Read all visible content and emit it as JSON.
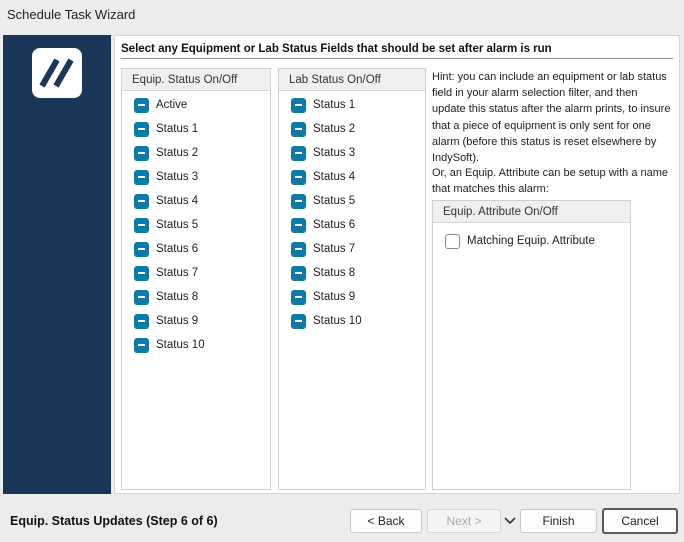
{
  "window": {
    "title": "Schedule Task Wizard"
  },
  "main": {
    "heading": "Select any Equipment or Lab Status Fields that should be set after alarm is run",
    "equip_panel": {
      "header": "Equip. Status On/Off",
      "items": [
        "Active",
        "Status 1",
        "Status 2",
        "Status 3",
        "Status 4",
        "Status 5",
        "Status 6",
        "Status 7",
        "Status 8",
        "Status 9",
        "Status 10"
      ]
    },
    "lab_panel": {
      "header": "Lab Status On/Off",
      "items": [
        "Status 1",
        "Status 2",
        "Status 3",
        "Status 4",
        "Status 5",
        "Status 6",
        "Status 7",
        "Status 8",
        "Status 9",
        "Status 10"
      ]
    },
    "hint": "Hint:  you can include an equipment or lab status field in your alarm selection filter, and then update this status after the alarm prints, to insure that a piece of equipment is only sent for one alarm (before this status is reset elsewhere by IndySoft).",
    "hint2": "Or, an Equip. Attribute can be setup with a name that matches this alarm:",
    "attr_panel": {
      "header": "Equip. Attribute On/Off",
      "item": "Matching Equip. Attribute"
    }
  },
  "footer": {
    "step_title": "Equip. Status Updates (Step 6 of 6)",
    "back": "< Back",
    "next": "Next >",
    "finish": "Finish",
    "cancel": "Cancel"
  },
  "colors": {
    "sidebar": "#1b3658",
    "checkbox": "#0e7aa8"
  }
}
